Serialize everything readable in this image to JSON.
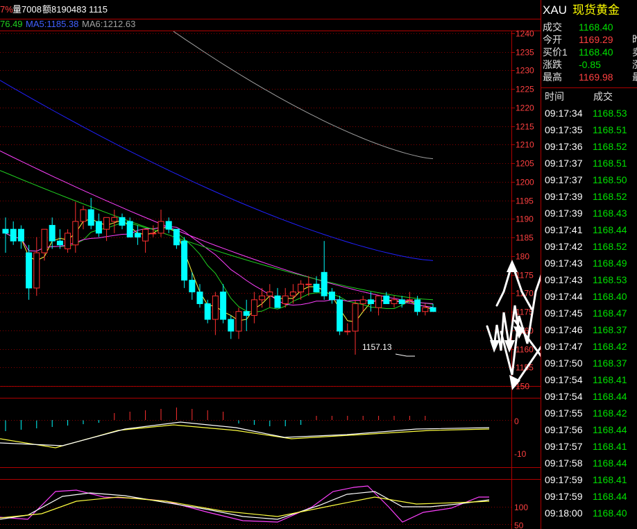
{
  "header": {
    "pct_fragment": "7%",
    "volume": "量7008",
    "amount": "额8190483",
    "count": "1115",
    "ma_fragment": "76.49",
    "ma5": "MA5:1185.38",
    "ma6": "MA6:1212.63"
  },
  "colors": {
    "up": "#ff3030",
    "down": "#00ffff",
    "grid": "#8b0000",
    "ma_yellow": "#ffff40",
    "ma_green": "#20d020",
    "ma_magenta": "#ff40ff",
    "ma_blue": "#2020ff",
    "ma_gray": "#a0a0a0"
  },
  "chart_data": {
    "type": "candlestick",
    "price_axis": {
      "ylim": [
        1150,
        1240
      ],
      "ticks": [
        "1240",
        "1235",
        "1230",
        "1225",
        "1220",
        "1215",
        "1210",
        "1205",
        "1200",
        "1195",
        "1190",
        "1185",
        "180",
        "1175",
        "1170",
        "1175",
        "1160",
        "1160",
        "1155",
        "150"
      ]
    },
    "annotation_low": "1157.13",
    "candles": [
      {
        "o": 1190,
        "h": 1193,
        "l": 1184,
        "c": 1189
      },
      {
        "o": 1190,
        "h": 1192,
        "l": 1186,
        "c": 1187
      },
      {
        "o": 1190,
        "h": 1191,
        "l": 1185,
        "c": 1187
      },
      {
        "o": 1184,
        "h": 1186,
        "l": 1172,
        "c": 1175
      },
      {
        "o": 1175,
        "h": 1188,
        "l": 1173,
        "c": 1184
      },
      {
        "o": 1184,
        "h": 1190,
        "l": 1182,
        "c": 1190
      },
      {
        "o": 1191,
        "h": 1193,
        "l": 1185,
        "c": 1187
      },
      {
        "o": 1187,
        "h": 1190,
        "l": 1185,
        "c": 1186
      },
      {
        "o": 1185,
        "h": 1190,
        "l": 1184,
        "c": 1189
      },
      {
        "o": 1186,
        "h": 1197,
        "l": 1184,
        "c": 1192
      },
      {
        "o": 1192,
        "h": 1196,
        "l": 1190,
        "c": 1195
      },
      {
        "o": 1195,
        "h": 1198,
        "l": 1190,
        "c": 1191
      },
      {
        "o": 1192,
        "h": 1194,
        "l": 1188,
        "c": 1189
      },
      {
        "o": 1190,
        "h": 1193,
        "l": 1187,
        "c": 1193
      },
      {
        "o": 1192,
        "h": 1195,
        "l": 1189,
        "c": 1193
      },
      {
        "o": 1193,
        "h": 1194,
        "l": 1190,
        "c": 1191
      },
      {
        "o": 1192,
        "h": 1193,
        "l": 1188,
        "c": 1188
      },
      {
        "o": 1189,
        "h": 1191,
        "l": 1186,
        "c": 1188
      },
      {
        "o": 1187,
        "h": 1190,
        "l": 1184,
        "c": 1190
      },
      {
        "o": 1189,
        "h": 1191,
        "l": 1188,
        "c": 1189
      },
      {
        "o": 1189,
        "h": 1195,
        "l": 1188,
        "c": 1192
      },
      {
        "o": 1192,
        "h": 1193,
        "l": 1189,
        "c": 1190
      },
      {
        "o": 1190,
        "h": 1190,
        "l": 1185,
        "c": 1186
      },
      {
        "o": 1187,
        "h": 1188,
        "l": 1175,
        "c": 1177
      },
      {
        "o": 1177,
        "h": 1179,
        "l": 1172,
        "c": 1174
      },
      {
        "o": 1174,
        "h": 1176,
        "l": 1170,
        "c": 1171
      },
      {
        "o": 1171,
        "h": 1172,
        "l": 1166,
        "c": 1167
      },
      {
        "o": 1167,
        "h": 1174,
        "l": 1163,
        "c": 1173
      },
      {
        "o": 1174,
        "h": 1176,
        "l": 1166,
        "c": 1167
      },
      {
        "o": 1167,
        "h": 1168,
        "l": 1162,
        "c": 1164
      },
      {
        "o": 1164,
        "h": 1170,
        "l": 1162,
        "c": 1169
      },
      {
        "o": 1169,
        "h": 1172,
        "l": 1164,
        "c": 1168
      },
      {
        "o": 1168,
        "h": 1174,
        "l": 1166,
        "c": 1172
      },
      {
        "o": 1172,
        "h": 1175,
        "l": 1170,
        "c": 1173
      },
      {
        "o": 1173,
        "h": 1176,
        "l": 1170,
        "c": 1174
      },
      {
        "o": 1173,
        "h": 1175,
        "l": 1170,
        "c": 1170
      },
      {
        "o": 1171,
        "h": 1175,
        "l": 1170,
        "c": 1173
      },
      {
        "o": 1173,
        "h": 1176,
        "l": 1171,
        "c": 1174
      },
      {
        "o": 1174,
        "h": 1177,
        "l": 1172,
        "c": 1176
      },
      {
        "o": 1176,
        "h": 1178,
        "l": 1173,
        "c": 1176
      },
      {
        "o": 1176,
        "h": 1178,
        "l": 1174,
        "c": 1174
      },
      {
        "o": 1179,
        "h": 1187,
        "l": 1172,
        "c": 1173
      },
      {
        "o": 1174,
        "h": 1175,
        "l": 1171,
        "c": 1172
      },
      {
        "o": 1172,
        "h": 1173,
        "l": 1163,
        "c": 1164
      },
      {
        "o": 1164,
        "h": 1166,
        "l": 1163,
        "c": 1164
      },
      {
        "o": 1164,
        "h": 1172,
        "l": 1158,
        "c": 1171
      },
      {
        "o": 1171,
        "h": 1173,
        "l": 1169,
        "c": 1172
      },
      {
        "o": 1172,
        "h": 1174,
        "l": 1169,
        "c": 1171
      },
      {
        "o": 1170,
        "h": 1173,
        "l": 1168,
        "c": 1173
      },
      {
        "o": 1173,
        "h": 1174,
        "l": 1171,
        "c": 1171
      },
      {
        "o": 1171,
        "h": 1173,
        "l": 1170,
        "c": 1172
      },
      {
        "o": 1172,
        "h": 1173,
        "l": 1170,
        "c": 1171
      },
      {
        "o": 1172,
        "h": 1174,
        "l": 1171,
        "c": 1172
      },
      {
        "o": 1172,
        "h": 1173,
        "l": 1168,
        "c": 1169
      },
      {
        "o": 1169,
        "h": 1171,
        "l": 1168,
        "c": 1170
      },
      {
        "o": 1170,
        "h": 1171,
        "l": 1169,
        "c": 1169
      }
    ],
    "macd_axis": {
      "ticks": [
        "0",
        "-10"
      ]
    },
    "kdj_axis": {
      "ticks": [
        "100",
        "50"
      ]
    }
  },
  "quote": {
    "symbol": "XAU",
    "name": "现货黄金",
    "rows": [
      {
        "label": "成交",
        "value": "1168.40",
        "color": "green",
        "extra": ""
      },
      {
        "label": "今开",
        "value": "1169.29",
        "color": "red",
        "extra": "昨"
      },
      {
        "label": "买价1",
        "value": "1168.40",
        "color": "green",
        "extra": "卖"
      },
      {
        "label": "涨跌",
        "value": "-0.85",
        "color": "green",
        "extra": "涨"
      },
      {
        "label": "最高",
        "value": "1169.98",
        "color": "red",
        "extra": "最"
      }
    ],
    "col_time": "时间",
    "col_price": "成交",
    "ticks": [
      {
        "t": "09:17:34",
        "p": "1168.53"
      },
      {
        "t": "09:17:35",
        "p": "1168.51"
      },
      {
        "t": "09:17:36",
        "p": "1168.52"
      },
      {
        "t": "09:17:37",
        "p": "1168.51"
      },
      {
        "t": "09:17:37",
        "p": "1168.50"
      },
      {
        "t": "09:17:39",
        "p": "1168.52"
      },
      {
        "t": "09:17:39",
        "p": "1168.43"
      },
      {
        "t": "09:17:41",
        "p": "1168.44"
      },
      {
        "t": "09:17:42",
        "p": "1168.52"
      },
      {
        "t": "09:17:43",
        "p": "1168.49"
      },
      {
        "t": "09:17:43",
        "p": "1168.53"
      },
      {
        "t": "09:17:44",
        "p": "1168.40"
      },
      {
        "t": "09:17:45",
        "p": "1168.47"
      },
      {
        "t": "09:17:46",
        "p": "1168.37"
      },
      {
        "t": "09:17:47",
        "p": "1168.42"
      },
      {
        "t": "09:17:50",
        "p": "1168.37"
      },
      {
        "t": "09:17:54",
        "p": "1168.41"
      },
      {
        "t": "09:17:54",
        "p": "1168.44"
      },
      {
        "t": "09:17:55",
        "p": "1168.42"
      },
      {
        "t": "09:17:56",
        "p": "1168.44"
      },
      {
        "t": "09:17:57",
        "p": "1168.41"
      },
      {
        "t": "09:17:58",
        "p": "1168.44"
      },
      {
        "t": "09:17:59",
        "p": "1168.41"
      },
      {
        "t": "09:17:59",
        "p": "1168.44"
      },
      {
        "t": "09:18:00",
        "p": "1168.40"
      }
    ]
  }
}
